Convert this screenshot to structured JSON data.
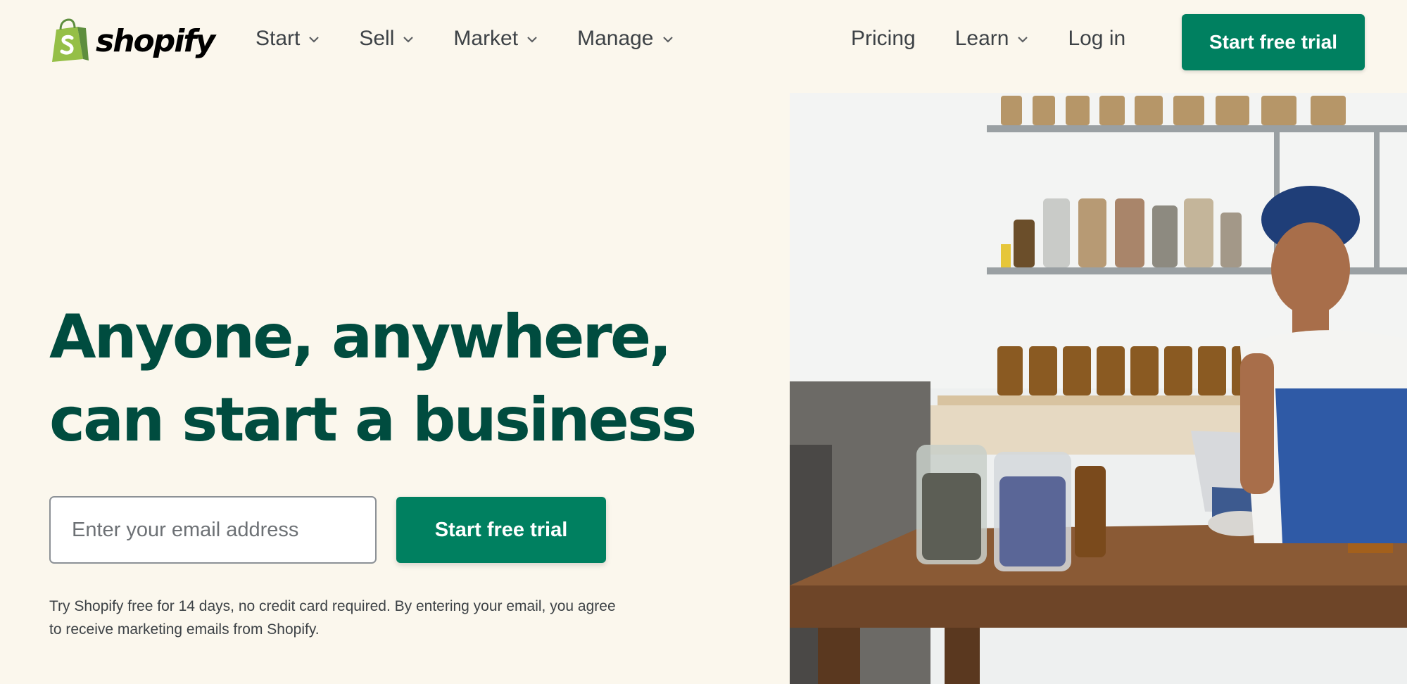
{
  "brand": {
    "name": "shopify",
    "accent": "#008060",
    "headline_color": "#004c3f",
    "background": "#fbf7ed"
  },
  "nav": {
    "left": [
      {
        "label": "Start",
        "has_dropdown": true
      },
      {
        "label": "Sell",
        "has_dropdown": true
      },
      {
        "label": "Market",
        "has_dropdown": true
      },
      {
        "label": "Manage",
        "has_dropdown": true
      }
    ],
    "right": [
      {
        "label": "Pricing",
        "has_dropdown": false
      },
      {
        "label": "Learn",
        "has_dropdown": true
      },
      {
        "label": "Log in",
        "has_dropdown": false
      }
    ],
    "cta_label": "Start free trial"
  },
  "hero": {
    "headline_line1": "Anyone, anywhere,",
    "headline_line2": "can start a business",
    "email_placeholder": "Enter your email address",
    "email_value": "",
    "cta_label": "Start free trial",
    "disclaimer": "Try Shopify free for 14 days, no credit card required. By entering your email, you agree to receive marketing emails from Shopify.",
    "image_icon": "shop-owner-photo"
  },
  "icons": {
    "logo": "shopping-bag-icon",
    "dropdown": "chevron-down-icon"
  }
}
